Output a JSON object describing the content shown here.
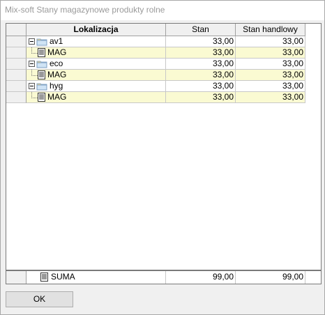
{
  "window": {
    "title": "Mix-soft Stany magazynowe produkty rolne"
  },
  "grid": {
    "columns": [
      "Lokalizacja",
      "Stan",
      "Stan handlowy"
    ],
    "rows": [
      {
        "label": "av1",
        "stan": "33,00",
        "stan_handlowy": "33,00",
        "children": [
          {
            "label": "MAG",
            "stan": "33,00",
            "stan_handlowy": "33,00"
          }
        ]
      },
      {
        "label": "eco",
        "stan": "33,00",
        "stan_handlowy": "33,00",
        "children": [
          {
            "label": "MAG",
            "stan": "33,00",
            "stan_handlowy": "33,00"
          }
        ]
      },
      {
        "label": "hyg",
        "stan": "33,00",
        "stan_handlowy": "33,00",
        "children": [
          {
            "label": "MAG",
            "stan": "33,00",
            "stan_handlowy": "33,00"
          }
        ]
      }
    ]
  },
  "summary": {
    "label": "SUMA",
    "stan": "99,00",
    "stan_handlowy": "99,00"
  },
  "buttons": {
    "ok_label": "OK"
  },
  "colors": {
    "child_row_bg": "#fafad2",
    "header_bg": "#f0f0f0"
  }
}
